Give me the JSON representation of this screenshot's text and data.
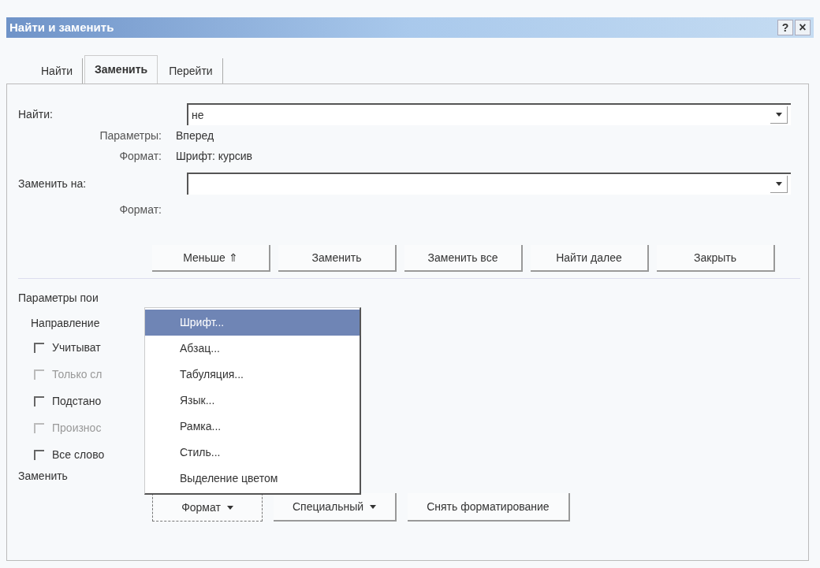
{
  "window": {
    "title": "Найти и заменить",
    "help": "?",
    "close": "×"
  },
  "tabs": [
    {
      "label": "Найти",
      "selected": false
    },
    {
      "label": "Заменить",
      "selected": true
    },
    {
      "label": "Перейти",
      "selected": false
    }
  ],
  "find": {
    "label": "Найти:",
    "value": "не"
  },
  "find_info": [
    {
      "label": "Параметры:",
      "value": "Вперед"
    },
    {
      "label": "Формат:",
      "value": "Шрифт: курсив"
    }
  ],
  "replace": {
    "label": "Заменить на:"
  },
  "replace_format": {
    "label": "Формат:"
  },
  "buttons": [
    "Меньше ⇑",
    "Заменить",
    "Заменить все",
    "Найти далее",
    "Закрыть"
  ],
  "search_options": {
    "title": "Параметры пои",
    "direction": "Направление",
    "checkboxes": [
      {
        "label": "Учитыват",
        "checked": false,
        "disabled": false
      },
      {
        "label": "Только сл",
        "checked": false,
        "disabled": true
      },
      {
        "label": "Подстано",
        "checked": false,
        "disabled": false
      },
      {
        "label": "Произнос",
        "checked": false,
        "disabled": true
      },
      {
        "label": "Все слово",
        "checked": false,
        "disabled": false
      }
    ]
  },
  "replace_section": "Заменить",
  "bottom_buttons": [
    {
      "label": "Формат",
      "dropdown": true,
      "focused": true
    },
    {
      "label": "Специальный",
      "dropdown": true,
      "focused": false
    },
    {
      "label": "Снять форматирование",
      "dropdown": false,
      "focused": false
    }
  ],
  "format_menu": [
    {
      "label": "Шрифт...",
      "selected": true
    },
    {
      "label": "Абзац...",
      "selected": false
    },
    {
      "label": "Табуляция...",
      "selected": false
    },
    {
      "label": "Язык...",
      "selected": false
    },
    {
      "label": "Рамка...",
      "selected": false
    },
    {
      "label": "Стиль...",
      "selected": false
    },
    {
      "label": "Выделение цветом",
      "selected": false
    }
  ]
}
